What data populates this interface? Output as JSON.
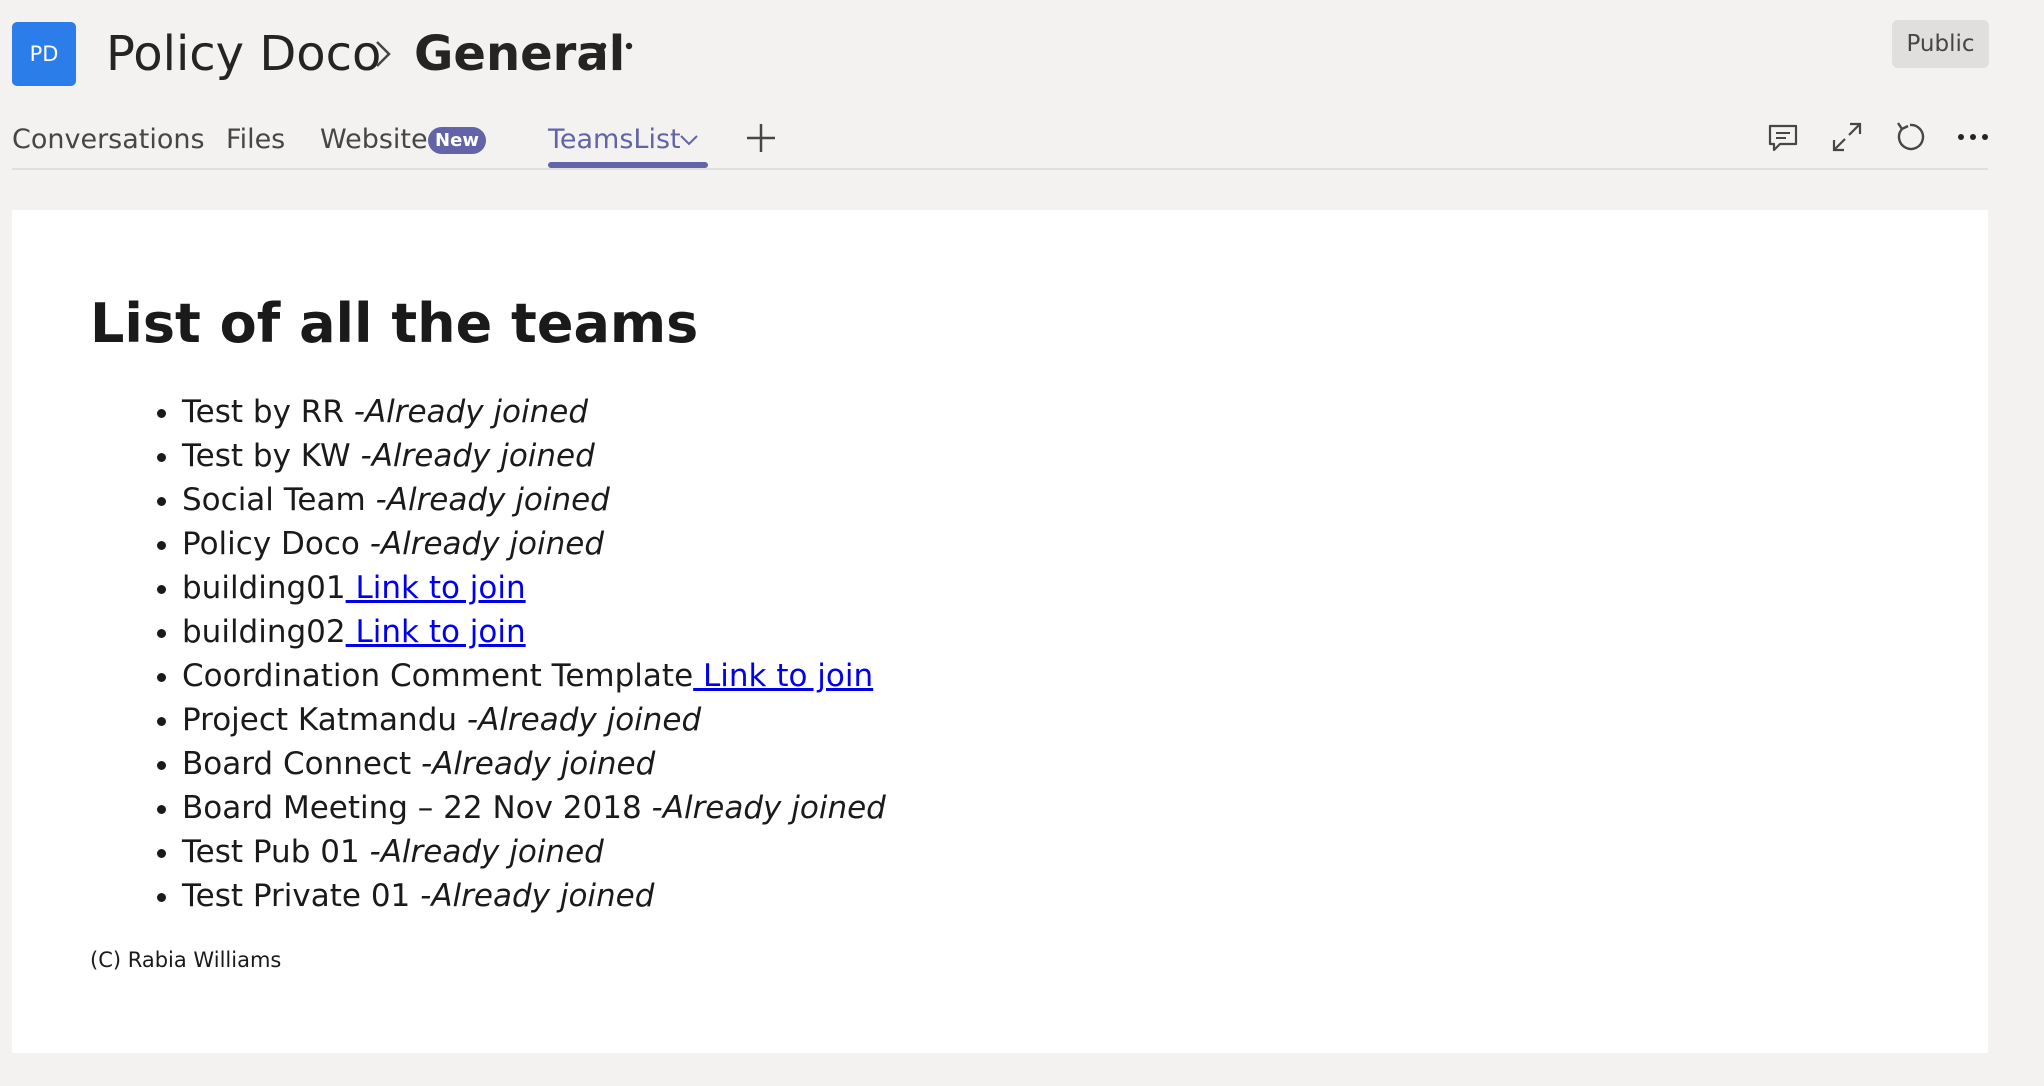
{
  "header": {
    "avatar_initials": "PD",
    "avatar_color": "#2b7de9",
    "team_name": "Policy Doco",
    "channel_name": "General",
    "visibility": "Public"
  },
  "tabs": {
    "conversations": "Conversations",
    "files": "Files",
    "website": "Website",
    "website_badge": "New",
    "teamslist": "TeamsList",
    "active": "TeamsList",
    "accent_color": "#6264a7"
  },
  "toolbar_icons": [
    "chat-icon",
    "expand-icon",
    "refresh-icon",
    "more-options-icon"
  ],
  "page": {
    "heading": "List of all the teams",
    "teams": [
      {
        "name": "Test by RR",
        "status": " -Already joined"
      },
      {
        "name": "Test by KW",
        "status": " -Already joined"
      },
      {
        "name": "Social Team",
        "status": " -Already joined"
      },
      {
        "name": "Policy Doco",
        "status": " -Already joined"
      },
      {
        "name": "building01",
        "link": " Link to join"
      },
      {
        "name": "building02",
        "link": " Link to join"
      },
      {
        "name": "Coordination Comment Template",
        "link": " Link to join"
      },
      {
        "name": "Project Katmandu",
        "status": " -Already joined"
      },
      {
        "name": "Board Connect",
        "status": " -Already joined"
      },
      {
        "name": "Board Meeting – 22 Nov 2018",
        "status": " -Already joined"
      },
      {
        "name": "Test Pub 01",
        "status": " -Already joined"
      },
      {
        "name": "Test Private 01",
        "status": " -Already joined"
      }
    ],
    "copyright": "(C) Rabia Williams"
  }
}
